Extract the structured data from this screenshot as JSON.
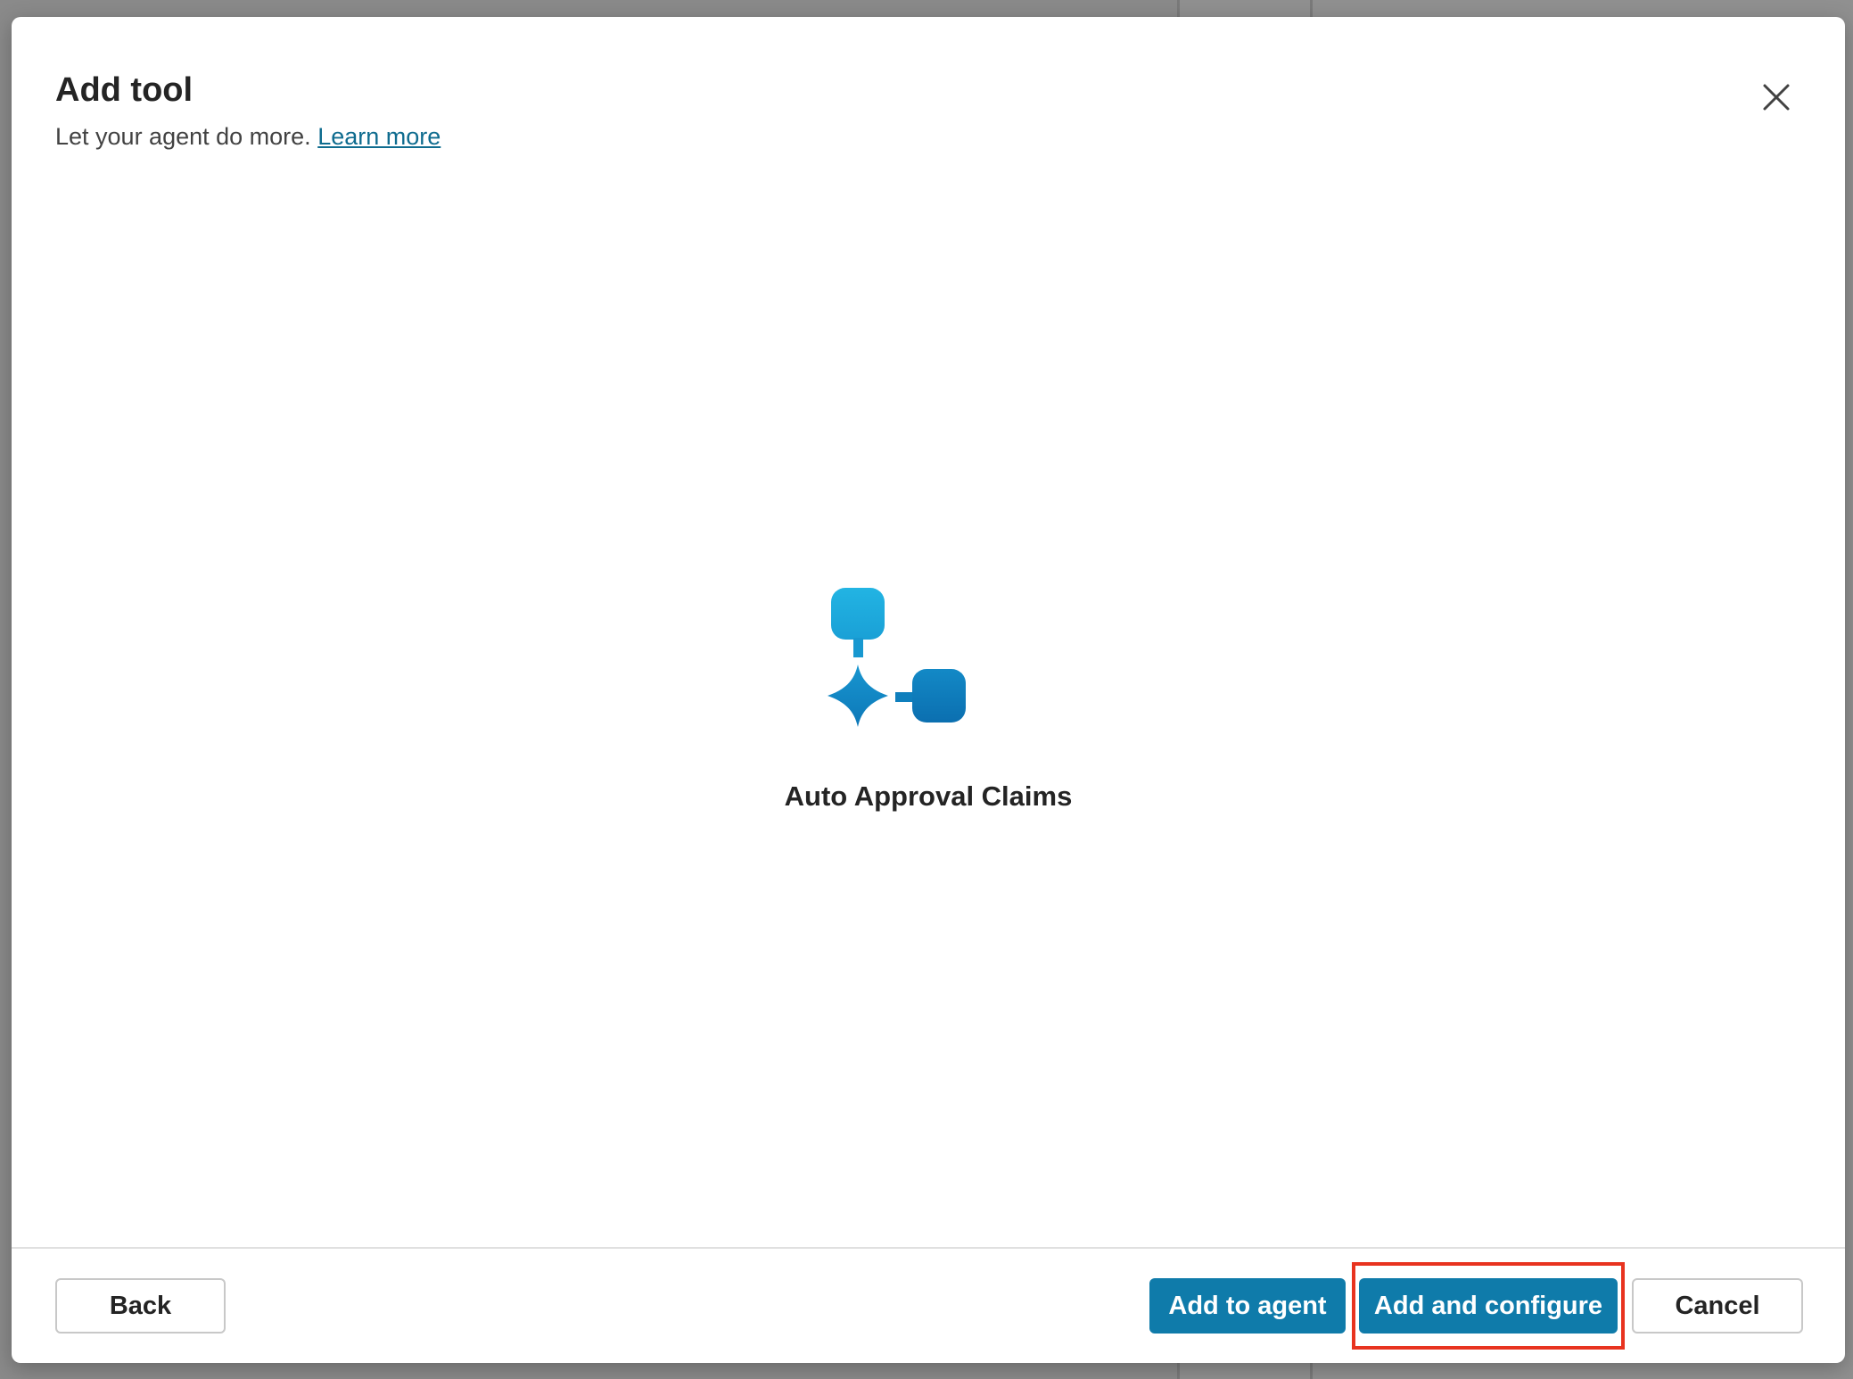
{
  "dialog": {
    "title": "Add tool",
    "subtitle_text": "Let your agent do more.",
    "learn_more_label": "Learn more",
    "close_icon": "close-icon"
  },
  "tool": {
    "name": "Auto Approval Claims",
    "icon": "connector-sparkle-icon",
    "colors": {
      "light_blue": "#1ea9dc",
      "dark_blue": "#0b72b5"
    }
  },
  "footer": {
    "back_label": "Back",
    "add_to_agent_label": "Add to agent",
    "add_and_configure_label": "Add and configure",
    "cancel_label": "Cancel"
  },
  "theme": {
    "primary": "#0f7baa",
    "link": "#0f6c8f",
    "highlight_border": "#e8331f"
  }
}
